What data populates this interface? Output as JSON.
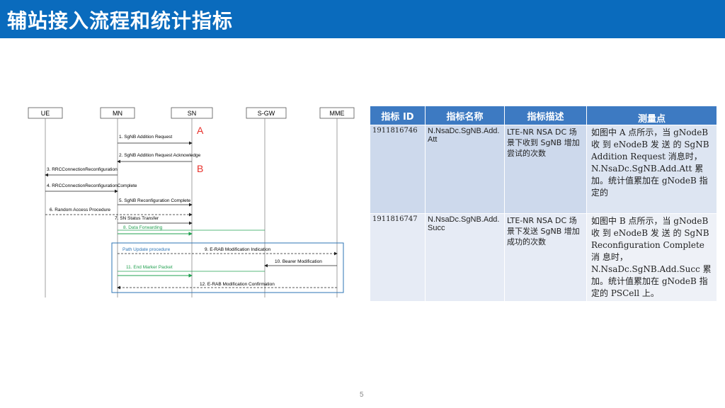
{
  "page": {
    "title": "辅站接入流程和统计指标",
    "page_number": "5"
  },
  "diagram": {
    "entities": [
      "UE",
      "MN",
      "SN",
      "S-GW",
      "MME"
    ],
    "markers": {
      "a": "A",
      "b": "B"
    },
    "messages": [
      "1. SgNB Addition Request",
      "2. SgNB Addition Request Acknowledge",
      "3. RRCConnectionReconfiguration",
      "4. RRCConnectionReconfigurationComplete",
      "5. SgNB Reconfiguration Complete",
      "6. Random Access Procedure",
      "7. SN Status Transfer",
      "8. Data Forwarding",
      "Path Update procedure",
      "9. E-RAB Modification Indication",
      "10. Bearer Modification",
      "11. End Marker Packet",
      "12. E-RAB Modification Confirmation"
    ],
    "colors": {
      "green": "#22a050",
      "box": "#2e75b6",
      "marker": "#e8302a"
    }
  },
  "table": {
    "headers": [
      "指标 ID",
      "指标名称",
      "指标描述",
      "测量点"
    ],
    "rows": [
      {
        "id": "1911816746",
        "name": "N.NsaDc.SgNB.Add.Att",
        "desc": "LTE-NR NSA DC 场景下收到 SgNB 增加尝试的次数",
        "meas": "如图中 A 点所示，当 gNodeB 收 到 eNodeB 发 送 的 SgNB Addition Request 消息时，N.NsaDc.SgNB.Add.Att 累加。统计值累加在 gNodeB 指定的"
      },
      {
        "id": "1911816747",
        "name": "N.NsaDc.SgNB.Add.Succ",
        "desc": "LTE-NR NSA DC 场景下发送 SgNB 增加成功的次数",
        "meas": "如图中 B 点所示，当 gNodeB 收 到 eNodeB 发 送 的 SgNB Reconfiguration Complete 消 息时，N.NsaDc.SgNB.Add.Succ 累加。统计值累加在 gNodeB 指定的 PSCell 上。"
      }
    ]
  }
}
